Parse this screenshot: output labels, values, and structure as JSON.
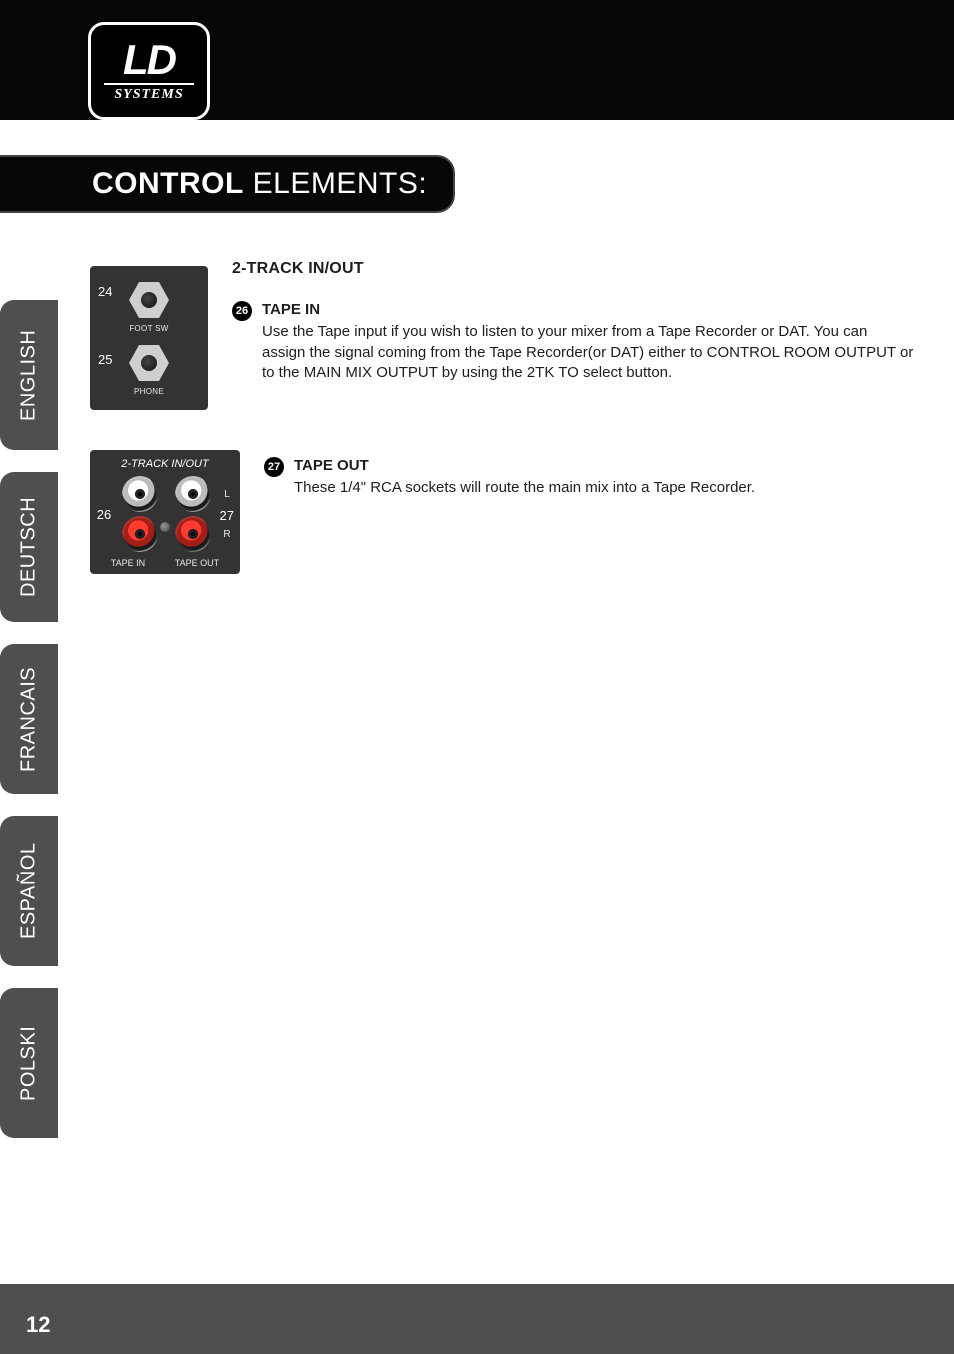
{
  "logo": {
    "ld": "LD",
    "systems": "SYSTEMS"
  },
  "title": {
    "bold": "CONTROL",
    "light": " ELEMENTS:"
  },
  "langs": [
    "ENGLISH",
    "DEUTSCH",
    "FRANCAIS",
    "ESPAÑOL",
    "POLSKI"
  ],
  "panel1": {
    "num_top": "24",
    "num_bottom": "25",
    "label_top": "FOOT SW",
    "label_bottom": "PHONE"
  },
  "panel2": {
    "header": "2-TRACK IN/OUT",
    "num_left": "26",
    "num_right": "27",
    "lr_top": "L",
    "lr_bottom": "R",
    "foot_left": "TAPE IN",
    "foot_right": "TAPE OUT"
  },
  "sectionA": {
    "heading": "2-TRACK IN/OUT",
    "item26": {
      "num": "26",
      "title": "TAPE IN",
      "body": "Use the Tape input if you wish to listen to your mixer from a Tape Recorder or DAT. You can assign the signal coming from the Tape Recorder(or DAT) either to CONTROL ROOM OUTPUT or to the MAIN MIX OUTPUT by using the 2TK TO select button."
    }
  },
  "sectionB": {
    "item27": {
      "num": "27",
      "title": "TAPE OUT",
      "body": "These 1/4\" RCA sockets will route the main mix into a Tape Recorder."
    }
  },
  "page_number": "12"
}
